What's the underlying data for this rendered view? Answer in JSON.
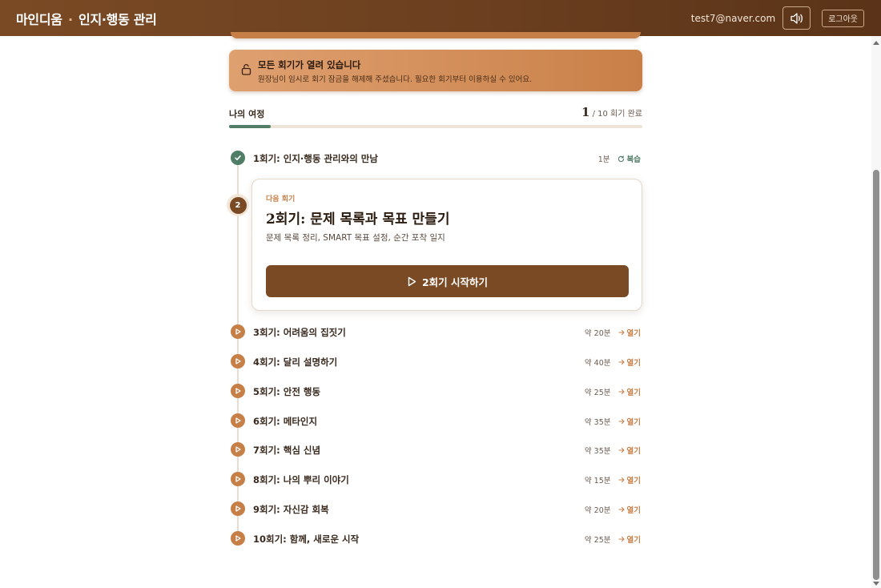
{
  "header": {
    "brand": "마인디움",
    "brand_separator": "·",
    "brand_sub": "인지·행동 관리",
    "email": "test7@naver.com",
    "sound_icon": "speaker-icon",
    "logout_label": "로그아웃"
  },
  "banner": {
    "icon": "unlock-icon",
    "title": "모든 회기가 열려 있습니다",
    "description": "원장님이 임시로 회기 잠금을 해제해 주셨습니다. 필요한 회기부터 이용하실 수 있어요."
  },
  "journey": {
    "label": "나의 여정",
    "completed": "1",
    "total_text": "/ 10 회기 완료",
    "progress_fraction": 0.1
  },
  "sessions": [
    {
      "title": "1회기: 인지·행동 관리와의 만남",
      "duration": "1분",
      "action": "복습",
      "status": "done",
      "icon": "check-icon",
      "action_icon": "refresh-icon"
    },
    {
      "title": "3회기: 어려움의 집짓기",
      "duration": "약 20분",
      "action": "열기",
      "status": "available",
      "icon": "play-icon",
      "action_icon": "arrow-right-icon"
    },
    {
      "title": "4회기: 달리 설명하기",
      "duration": "약 40분",
      "action": "열기",
      "status": "available",
      "icon": "play-icon",
      "action_icon": "arrow-right-icon"
    },
    {
      "title": "5회기: 안전 행동",
      "duration": "약 25분",
      "action": "열기",
      "status": "available",
      "icon": "play-icon",
      "action_icon": "arrow-right-icon"
    },
    {
      "title": "6회기: 메타인지",
      "duration": "약 35분",
      "action": "열기",
      "status": "available",
      "icon": "play-icon",
      "action_icon": "arrow-right-icon"
    },
    {
      "title": "7회기: 핵심 신념",
      "duration": "약 35분",
      "action": "열기",
      "status": "available",
      "icon": "play-icon",
      "action_icon": "arrow-right-icon"
    },
    {
      "title": "8회기: 나의 뿌리 이야기",
      "duration": "약 15분",
      "action": "열기",
      "status": "available",
      "icon": "play-icon",
      "action_icon": "arrow-right-icon"
    },
    {
      "title": "9회기: 자신감 회복",
      "duration": "약 20분",
      "action": "열기",
      "status": "available",
      "icon": "play-icon",
      "action_icon": "arrow-right-icon"
    },
    {
      "title": "10회기: 함께, 새로운 시작",
      "duration": "약 25분",
      "action": "열기",
      "status": "available",
      "icon": "play-icon",
      "action_icon": "arrow-right-icon"
    }
  ],
  "next_session": {
    "number": "2",
    "eyebrow": "다음 회기",
    "title": "2회기: 문제 목록과 목표 만들기",
    "description": "문제 목록 정리, SMART 목표 설정, 순간 포착 일지",
    "button_label": "2회기 시작하기",
    "button_icon": "play-icon"
  },
  "colors": {
    "header": "#6b3f1f",
    "accent": "#c77f48",
    "done": "#4f7d66",
    "primary_button": "#7a4a24"
  }
}
